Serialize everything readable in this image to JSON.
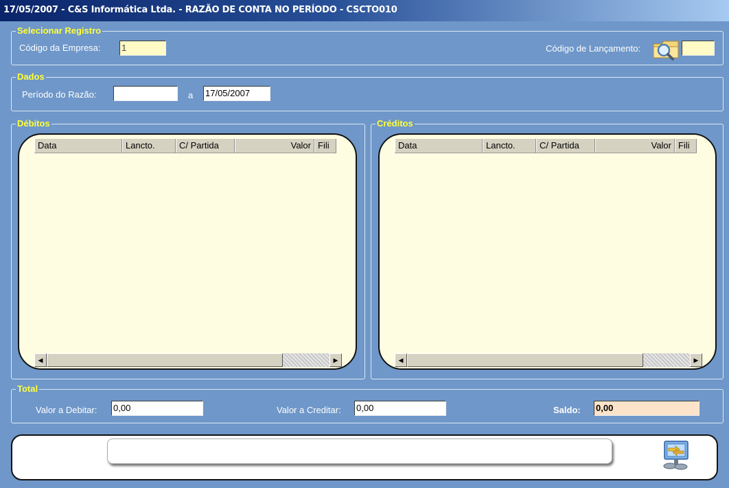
{
  "window": {
    "title": "17/05/2007  -  C&S Informática Ltda.  -  RAZÃO DE CONTA NO PERÍODO  -  CSCTO010"
  },
  "selecionar": {
    "legend": "Selecionar Registro",
    "empresa_label": "Código da Empresa:",
    "empresa_value": "1",
    "lancamento_label": "Código de Lançamento:",
    "lancamento_value": ""
  },
  "dados": {
    "legend": "Dados",
    "periodo_label": "Período do Razão:",
    "periodo_inicio": "",
    "separator": "a",
    "periodo_fim": "17/05/2007"
  },
  "debitos": {
    "legend": "Débitos",
    "columns": [
      "Data",
      "Lancto.",
      "C/ Partida",
      "Valor",
      "Fili"
    ]
  },
  "creditos": {
    "legend": "Créditos",
    "columns": [
      "Data",
      "Lancto.",
      "C/ Partida",
      "Valor",
      "Fili"
    ]
  },
  "total": {
    "legend": "Total",
    "debitar_label": "Valor a Debitar:",
    "debitar_value": "0,00",
    "creditar_label": "Valor a Creditar:",
    "creditar_value": "0,00",
    "saldo_label": "Saldo:",
    "saldo_value": "0,00"
  },
  "status": {
    "message": ""
  },
  "icons": {
    "search": "magnifier-folder-icon",
    "exit": "exit-arrows-icon",
    "scroll_left": "scroll-left-arrow-icon",
    "scroll_right": "scroll-right-arrow-icon"
  },
  "colors": {
    "background": "#6f97c9",
    "legend_text": "#ffff3c",
    "grid_background": "#fefde1",
    "saldo_field": "#fde3c9"
  }
}
